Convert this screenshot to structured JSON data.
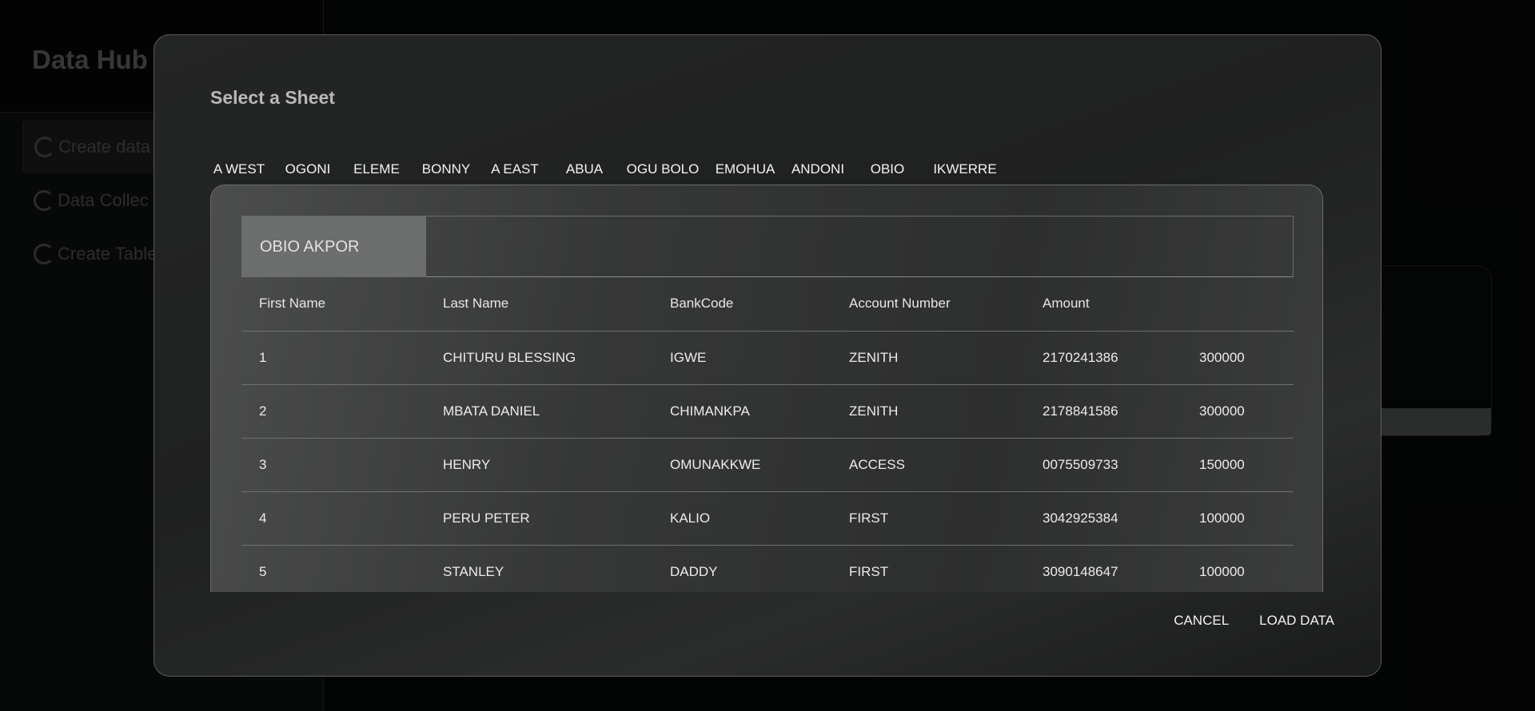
{
  "app": {
    "brand": "Data Hub",
    "nav": [
      {
        "label": "Create data"
      },
      {
        "label": "Data Collec"
      },
      {
        "label": "Create Table"
      }
    ]
  },
  "dialog": {
    "title": "Select a Sheet",
    "sheets": [
      "A WEST",
      "OGONI",
      "ELEME",
      "BONNY",
      "A EAST",
      "ABUA",
      "OGU BOLO",
      "EMOHUA",
      "ANDONI",
      "OBIO",
      "IKWERRE"
    ],
    "active_table_tab": "OBIO AKPOR",
    "table": {
      "headers": [
        "First Name",
        "Last Name",
        "BankCode",
        "Account Number",
        "Amount",
        ""
      ],
      "rows": [
        [
          "1",
          "CHITURU BLESSING",
          "IGWE",
          "ZENITH",
          "2170241386",
          "300000"
        ],
        [
          "2",
          "MBATA DANIEL",
          "CHIMANKPA",
          "ZENITH",
          "2178841586",
          "300000"
        ],
        [
          "3",
          "HENRY",
          "OMUNAKKWE",
          "ACCESS",
          "0075509733",
          "150000"
        ],
        [
          "4",
          "PERU PETER",
          "KALIO",
          "FIRST",
          "3042925384",
          "100000"
        ],
        [
          "5",
          "STANLEY",
          "DADDY",
          "FIRST",
          "3090148647",
          "100000"
        ]
      ]
    },
    "actions": {
      "cancel": "CANCEL",
      "load": "LOAD DATA"
    }
  }
}
